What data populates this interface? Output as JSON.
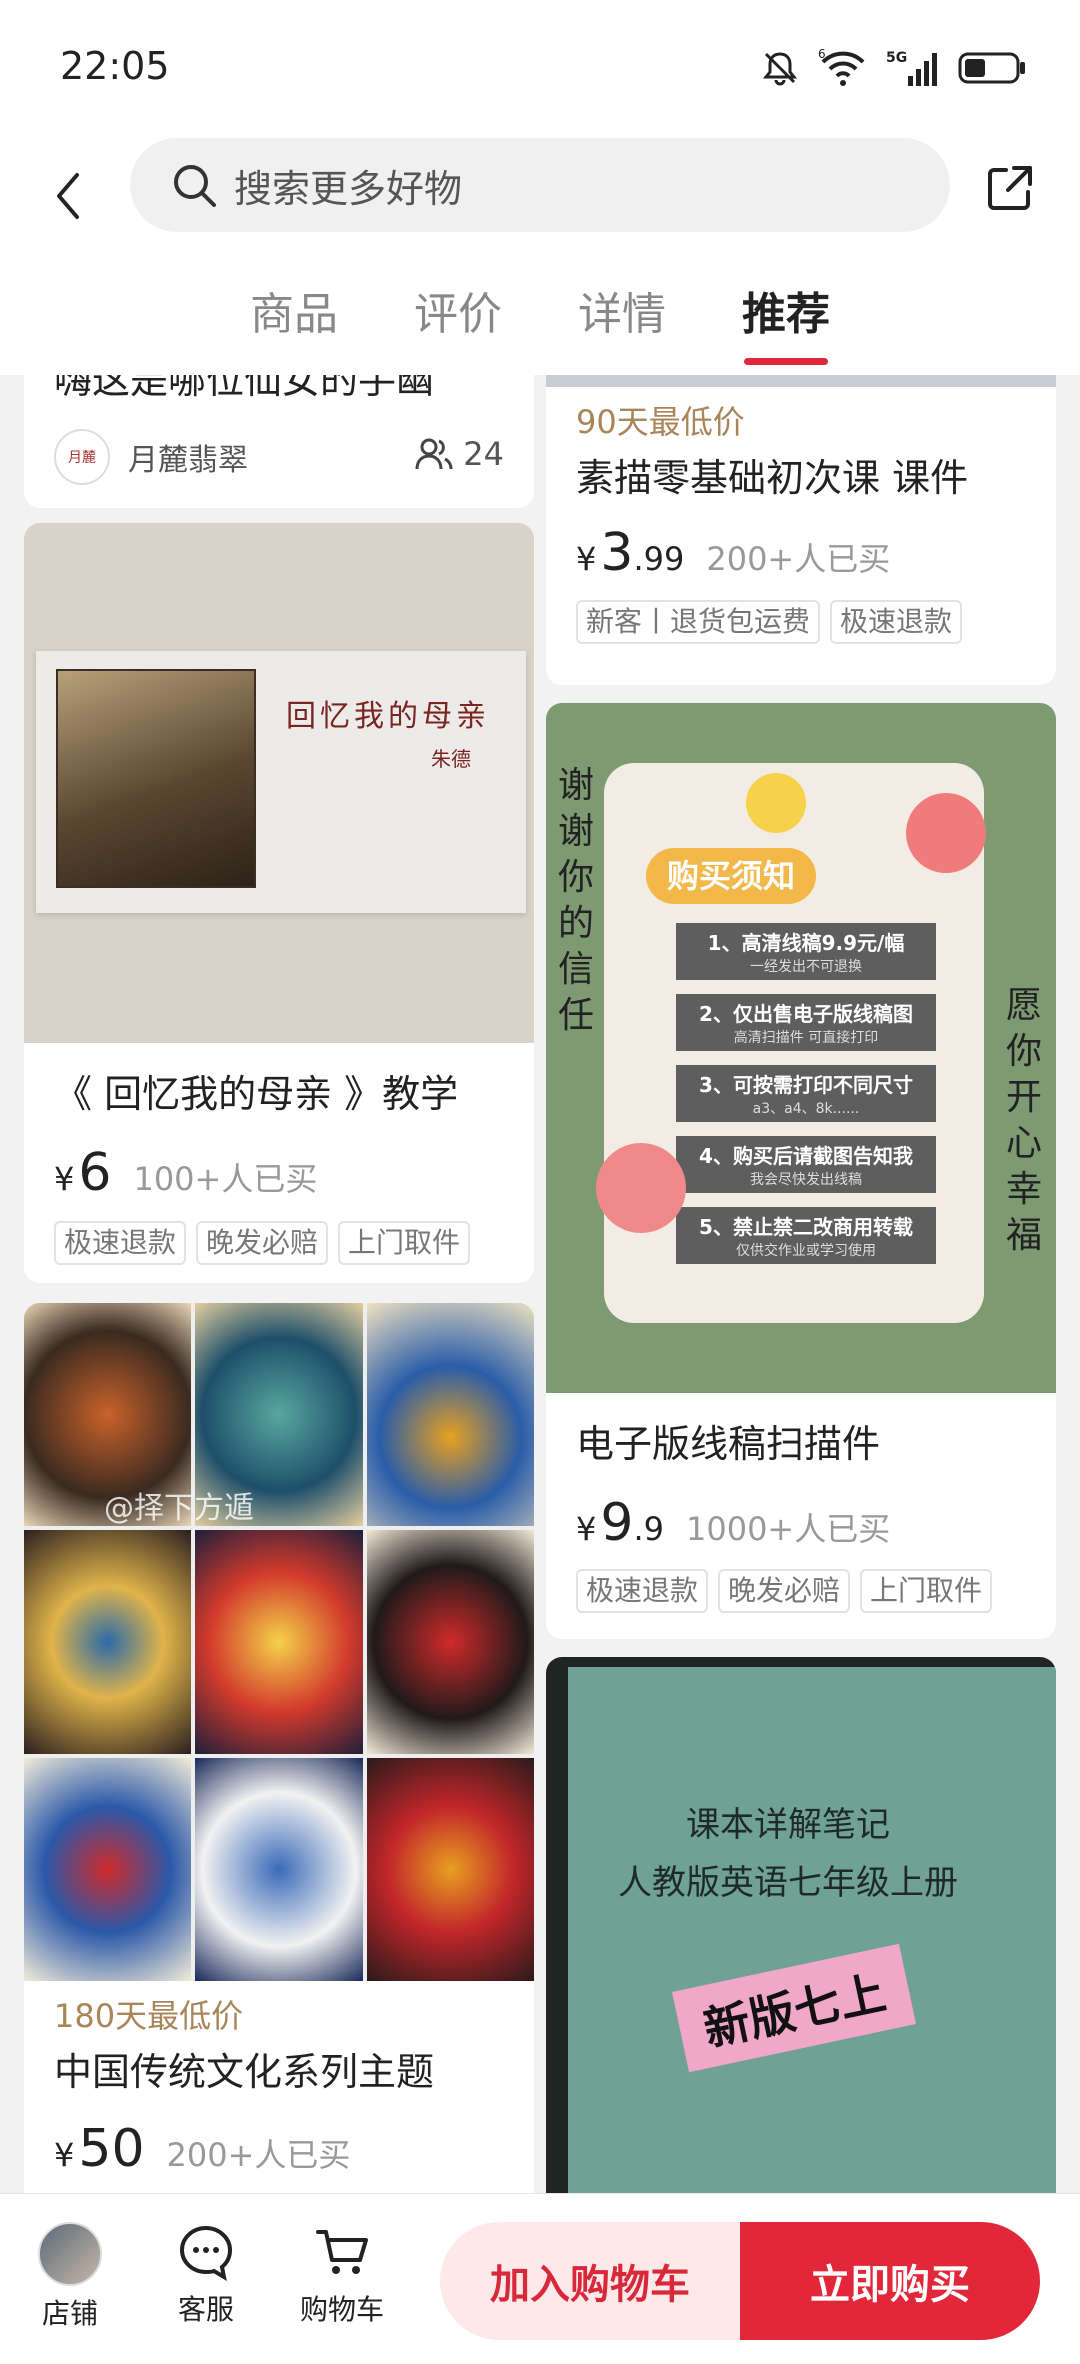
{
  "status": {
    "time": "22:05",
    "net_label": "5G",
    "wifi_label": "6"
  },
  "search": {
    "placeholder": "搜索更多好物"
  },
  "tabs": [
    {
      "label": "商品"
    },
    {
      "label": "评价"
    },
    {
      "label": "详情"
    },
    {
      "label": "推荐"
    }
  ],
  "active_tab": "推荐",
  "feed": {
    "left": [
      {
        "title": "嗨这是哪位仙女的手幽",
        "seller": "月麓翡翠",
        "viewers": "24"
      },
      {
        "image_title": "回忆我的母亲",
        "image_author": "朱德",
        "title": "《 回忆我的母亲 》教学",
        "price_yen": "¥",
        "price_int": "6",
        "price_dec": "",
        "sold": "100+人已买",
        "tags": [
          "极速退款",
          "晚发必赔",
          "上门取件"
        ]
      },
      {
        "watermark": "@择下方遁",
        "lowprice": "180天最低价",
        "title": "中国传统文化系列主题",
        "price_yen": "¥",
        "price_int": "50",
        "price_dec": "",
        "sold": "200+人已买"
      }
    ],
    "right": [
      {
        "lowprice": "90天最低价",
        "title": "素描零基础初次课 课件",
        "price_yen": "¥",
        "price_int": "3",
        "price_dec": ".99",
        "sold": "200+人已买",
        "tags": [
          "新客丨退货包运费",
          "极速退款"
        ]
      },
      {
        "poster": {
          "side_left": "谢谢你的信任",
          "side_right": "愿你开心幸福",
          "heading": "购买须知",
          "rules": [
            {
              "main": "1、高清线稿9.9元/幅",
              "sub": "一经发出不可退换"
            },
            {
              "main": "2、仅出售电子版线稿图",
              "sub": "高清扫描件 可直接打印"
            },
            {
              "main": "3、可按需打印不同尺寸",
              "sub": "a3、a4、8k......"
            },
            {
              "main": "4、购买后请截图告知我",
              "sub": "我会尽快发出线稿"
            },
            {
              "main": "5、禁止禁二改商用转载",
              "sub": "仅供交作业或学习使用"
            }
          ]
        },
        "title": "电子版线稿扫描件",
        "price_yen": "¥",
        "price_int": "9",
        "price_dec": ".9",
        "sold": "1000+人已买",
        "tags": [
          "极速退款",
          "晚发必赔",
          "上门取件"
        ]
      },
      {
        "book_line1": "课本详解笔记",
        "book_line2": "人教版英语七年级上册",
        "sticker": "新版七上"
      }
    ]
  },
  "bottom": {
    "shop": "店铺",
    "service": "客服",
    "cart": "购物车",
    "add_to_cart": "加入购物车",
    "buy_now": "立即购买"
  },
  "colors": {
    "accent": "#e3273a",
    "accent_light": "#fde9ea",
    "lowprice": "#a9855a",
    "poster_bg": "#7e9a73",
    "book_bg": "#6fa294"
  }
}
